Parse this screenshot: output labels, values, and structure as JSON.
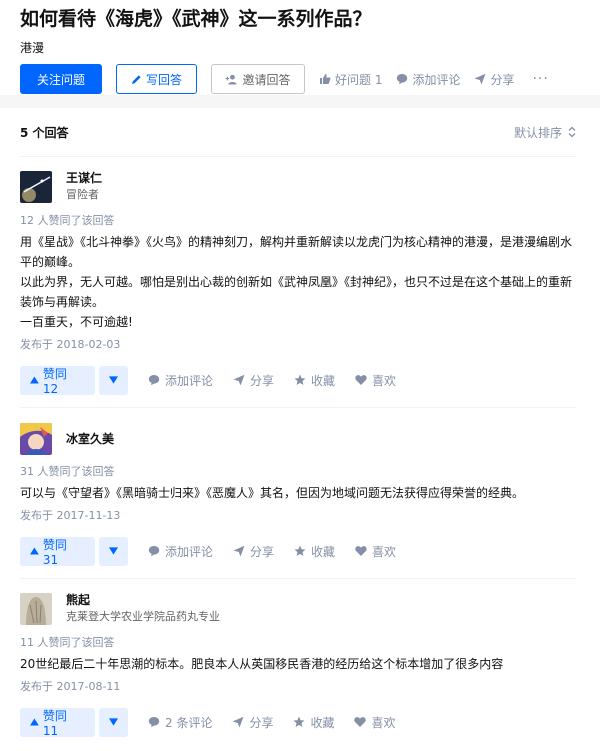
{
  "question": {
    "title": "如何看待《海虎》《武神》这一系列作品？",
    "topic": "港漫",
    "follow_label": "关注问题",
    "write_label": "写回答",
    "invite_label": "邀请回答",
    "good_question_label": "好问题 1",
    "add_comment_label": "添加评论",
    "share_label": "分享",
    "more_label": "···"
  },
  "answers_section": {
    "count_label": "5 个回答",
    "sort_label": "默认排序"
  },
  "answers": [
    {
      "author": "王谋仁",
      "bio": "冒险者",
      "votes_line": "12 人赞同了该回答",
      "paragraphs": [
        "用《星战》《北斗神拳》《火鸟》的精神刻刀，解构并重新解读以龙虎门为核心精神的港漫，是港漫编剧水平的巅峰。",
        "以此为界，无人可越。哪怕是别出心裁的创新如《武神凤凰》《封神纪》，也只不过是在这个基础上的重新装饰与再解读。",
        "一百重天，不可逾越!"
      ],
      "date": "发布于 2018-02-03",
      "vote_label": "赞同 12",
      "comment_label": "添加评论",
      "share_label": "分享",
      "collect_label": "收藏",
      "like_label": "喜欢"
    },
    {
      "author": "冰室久美",
      "bio": "",
      "votes_line": "31 人赞同了该回答",
      "paragraphs": [
        "可以与《守望者》《黑暗骑士归来》《恶魔人》其名，但因为地域问题无法获得应得荣誉的经典。"
      ],
      "date": "发布于 2017-11-13",
      "vote_label": "赞同 31",
      "comment_label": "添加评论",
      "share_label": "分享",
      "collect_label": "收藏",
      "like_label": "喜欢"
    },
    {
      "author": "熊起",
      "bio": "克莱登大学农业学院品药丸专业",
      "votes_line": "11 人赞同了该回答",
      "paragraphs": [
        "20世纪最后二十年思潮的标本。肥良本人从英国移民香港的经历给这个标本增加了很多内容"
      ],
      "date": "发布于 2017-08-11",
      "vote_label": "赞同 11",
      "comment_label": "2 条评论",
      "share_label": "分享",
      "collect_label": "收藏",
      "like_label": "喜欢"
    }
  ],
  "colors": {
    "brand_blue": "#0066ff",
    "meta_gray": "#8590a6",
    "text": "#121212"
  },
  "icons": [
    "pencil-icon",
    "invite-user-icon",
    "thumb-up-icon",
    "comment-icon",
    "share-icon",
    "sort-icon",
    "vote-up-triangle-icon",
    "vote-down-triangle-icon",
    "star-icon",
    "heart-icon"
  ]
}
